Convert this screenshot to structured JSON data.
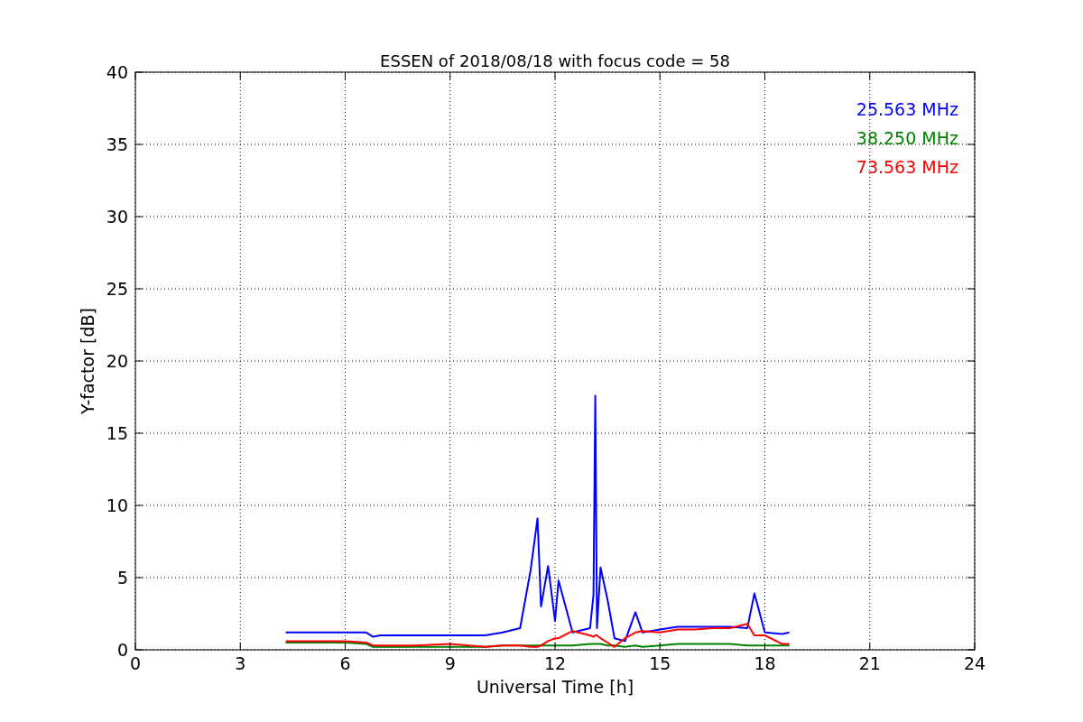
{
  "chart_data": {
    "type": "line",
    "title": "ESSEN of 2018/08/18 with focus code = 58",
    "xlabel": "Universal Time [h]",
    "ylabel": "Y-factor [dB]",
    "x": [
      4.3,
      5,
      6,
      6.6,
      6.8,
      7,
      8,
      9,
      10,
      10.5,
      11,
      11.3,
      11.5,
      11.6,
      11.8,
      12,
      12.1,
      12.5,
      13,
      13.1,
      13.15,
      13.2,
      13.3,
      13.5,
      13.7,
      14,
      14.3,
      14.5,
      15,
      15.5,
      16,
      16.5,
      17,
      17.5,
      17.7,
      18,
      18.5,
      18.7
    ],
    "series": [
      {
        "name": "25.563 MHz",
        "color": "#0000ff",
        "values": [
          1.2,
          1.2,
          1.2,
          1.2,
          0.9,
          1.0,
          1.0,
          1.0,
          1.0,
          1.2,
          1.5,
          5.5,
          9.1,
          3,
          5.8,
          2,
          4.8,
          1.2,
          1.5,
          3.8,
          17.6,
          1.5,
          5.7,
          3.5,
          0.8,
          0.6,
          2.6,
          1.2,
          1.4,
          1.6,
          1.6,
          1.6,
          1.6,
          1.5,
          3.9,
          1.2,
          1.1,
          1.2
        ]
      },
      {
        "name": "38.250 MHz",
        "color": "#008000",
        "values": [
          0.5,
          0.5,
          0.5,
          0.4,
          0.2,
          0.2,
          0.2,
          0.2,
          0.2,
          0.3,
          0.3,
          0.3,
          0.3,
          0.3,
          0.3,
          0.3,
          0.3,
          0.3,
          0.4,
          0.4,
          0.4,
          0.4,
          0.4,
          0.3,
          0.3,
          0.2,
          0.3,
          0.2,
          0.3,
          0.4,
          0.4,
          0.4,
          0.4,
          0.3,
          0.3,
          0.3,
          0.3,
          0.3
        ]
      },
      {
        "name": "73.563 MHz",
        "color": "#ff0000",
        "values": [
          0.6,
          0.6,
          0.6,
          0.5,
          0.3,
          0.3,
          0.3,
          0.4,
          0.2,
          0.3,
          0.3,
          0.2,
          0.2,
          0.3,
          0.6,
          0.8,
          0.8,
          1.3,
          1.0,
          0.9,
          1.0,
          1.0,
          0.8,
          0.5,
          0.2,
          0.8,
          1.2,
          1.3,
          1.2,
          1.4,
          1.4,
          1.5,
          1.5,
          1.8,
          1.0,
          1.0,
          0.4,
          0.4
        ]
      }
    ],
    "grid": true,
    "xlim": [
      0,
      24
    ],
    "ylim": [
      0,
      40
    ],
    "xticks": [
      0,
      3,
      6,
      9,
      12,
      15,
      18,
      21,
      24
    ],
    "yticks": [
      0,
      5,
      10,
      15,
      20,
      25,
      30,
      35,
      40
    ]
  }
}
